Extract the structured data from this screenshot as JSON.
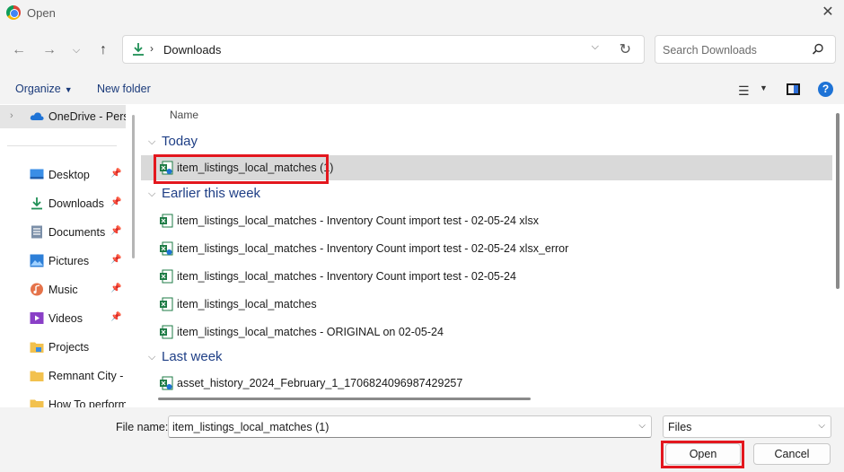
{
  "window": {
    "title": "Open",
    "close_glyph": "✕"
  },
  "nav": {
    "back": "←",
    "forward": "→",
    "recent": "⌵",
    "up": "↑",
    "address_crumb": "Downloads",
    "address_sep": "›",
    "address_dropdown": "⌵",
    "refresh": "↻",
    "search_placeholder": "Search Downloads"
  },
  "toolbar": {
    "organize": "Organize",
    "organize_caret": "▼",
    "new_folder": "New folder",
    "view_glyph": "☰",
    "view_caret": "▼",
    "help": "?"
  },
  "sidebar": {
    "onedrive": {
      "label": "OneDrive - Perso",
      "expander": "›"
    },
    "items": [
      {
        "label": "Desktop",
        "icon": "desktop-icon",
        "pinned": true
      },
      {
        "label": "Downloads",
        "icon": "download-icon",
        "pinned": true
      },
      {
        "label": "Documents",
        "icon": "document-icon",
        "pinned": true
      },
      {
        "label": "Pictures",
        "icon": "picture-icon",
        "pinned": true
      },
      {
        "label": "Music",
        "icon": "music-icon",
        "pinned": true
      },
      {
        "label": "Videos",
        "icon": "video-icon",
        "pinned": true
      },
      {
        "label": "Projects",
        "icon": "folder-icon",
        "pinned": false
      },
      {
        "label": "Remnant City - (",
        "icon": "folder-icon",
        "pinned": false
      },
      {
        "label": "How To perform",
        "icon": "folder-icon",
        "pinned": false
      }
    ],
    "pin_glyph": "📌"
  },
  "filelist": {
    "column_name": "Name",
    "group_chevron": "⌵",
    "groups": [
      {
        "label": "Today",
        "files": [
          {
            "name": "item_listings_local_matches (1)",
            "selected": true
          }
        ]
      },
      {
        "label": "Earlier this week",
        "files": [
          {
            "name": "item_listings_local_matches - Inventory Count import test - 02-05-24 xlsx",
            "selected": false
          },
          {
            "name": "item_listings_local_matches - Inventory Count import test - 02-05-24 xlsx_error",
            "selected": false
          },
          {
            "name": "item_listings_local_matches - Inventory Count import test - 02-05-24",
            "selected": false
          },
          {
            "name": "item_listings_local_matches",
            "selected": false
          },
          {
            "name": "item_listings_local_matches - ORIGINAL on 02-05-24",
            "selected": false
          }
        ]
      },
      {
        "label": "Last week",
        "files": [
          {
            "name": "asset_history_2024_February_1_1706824096987429257",
            "selected": false
          }
        ]
      }
    ]
  },
  "footer": {
    "file_name_label": "File name:",
    "file_name_value": "item_listings_local_matches (1)",
    "file_type_value": "Files",
    "dropdown_glyph": "⌵",
    "open_label": "Open",
    "cancel_label": "Cancel"
  },
  "colors": {
    "highlight_box": "#e3171e",
    "accent_blue": "#1e73d6",
    "excel_green": "#1d7b45"
  }
}
